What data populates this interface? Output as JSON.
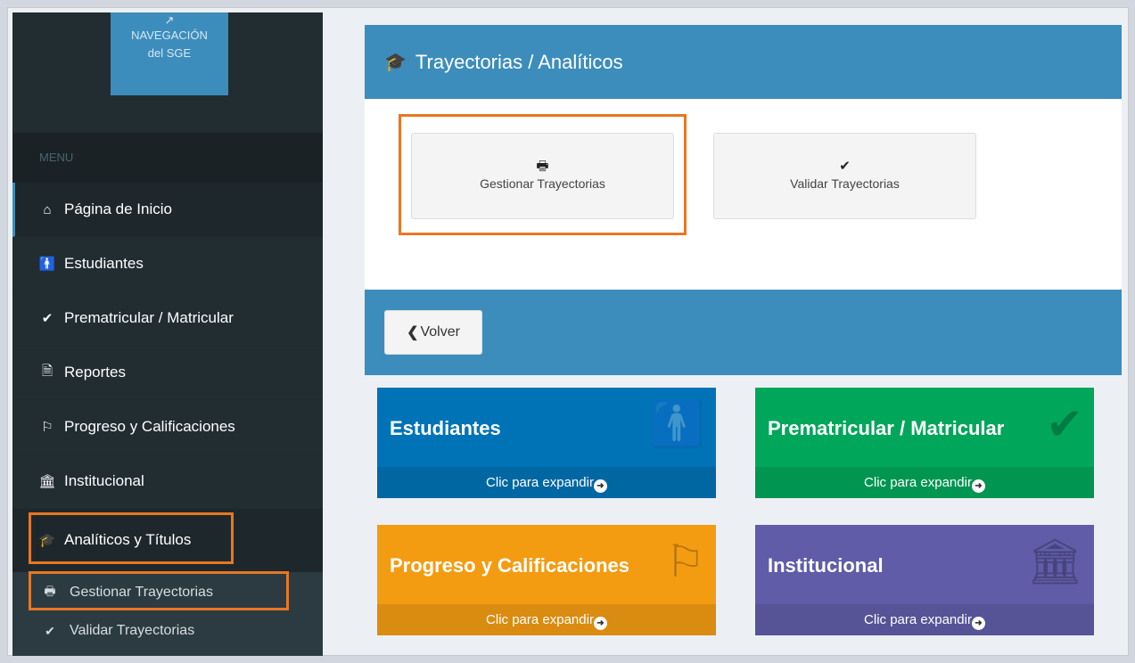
{
  "sidebar": {
    "nav_sge": {
      "line1": "NAVEGACIÓN",
      "line2": "del SGE",
      "icon": "external-link-icon"
    },
    "menu_header": "MENU",
    "items": [
      {
        "label": "Página de Inicio",
        "icon": "home-icon"
      },
      {
        "label": "Estudiantes",
        "icon": "student-icon"
      },
      {
        "label": "Prematricular / Matricular",
        "icon": "check-icon"
      },
      {
        "label": "Reportes",
        "icon": "document-icon"
      },
      {
        "label": "Progreso y Calificaciones",
        "icon": "flag-icon"
      },
      {
        "label": "Institucional",
        "icon": "institution-icon"
      },
      {
        "label": "Analíticos y Títulos",
        "icon": "graduation-cap-icon"
      }
    ],
    "submenu": [
      {
        "label": "Gestionar Trayectorias",
        "icon": "print-icon"
      },
      {
        "label": "Validar Trayectorias",
        "icon": "check-icon"
      }
    ]
  },
  "panel": {
    "title": "Trayectorias / Analíticos",
    "icon": "graduation-cap-icon",
    "buttons": [
      {
        "label": "Gestionar Trayectorias",
        "icon": "print-icon"
      },
      {
        "label": "Validar Trayectorias",
        "icon": "check-icon"
      }
    ]
  },
  "back_label": "Volver",
  "boxes": [
    {
      "title": "Estudiantes",
      "footer": "Clic para expandir",
      "color": "#0073b7",
      "footer_color": "#0067a3",
      "icon": "student-icon"
    },
    {
      "title": "Prematricular / Matricular",
      "footer": "Clic para expandir",
      "color": "#00a65a",
      "footer_color": "#009551",
      "icon": "check-icon"
    },
    {
      "title": "Progreso y Calificaciones",
      "footer": "Clic para expandir",
      "color": "#f39c12",
      "footer_color": "#da8c10",
      "icon": "flag-icon"
    },
    {
      "title": "Institucional",
      "footer": "Clic para expandir",
      "color": "#605ca8",
      "footer_color": "#565397",
      "icon": "institution-icon"
    }
  ],
  "colors": {
    "accent": "#3c8dbc",
    "sidebar_bg": "#222d32",
    "highlight": "#e87722"
  }
}
